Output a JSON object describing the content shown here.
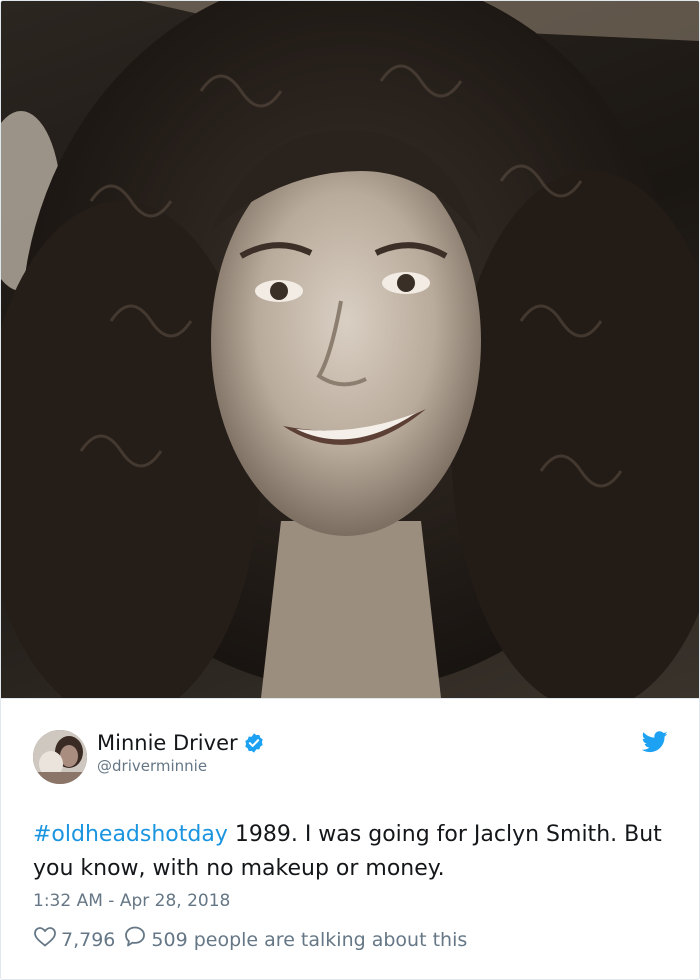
{
  "tweet": {
    "author": {
      "display_name": "Minnie Driver",
      "handle": "@driverminnie",
      "verified": true
    },
    "text": {
      "hashtag": "#oldheadshotday",
      "body": " 1989. I was going for Jaclyn Smith. But you know, with no makeup or money."
    },
    "timestamp": "1:32 AM - Apr 28, 2018",
    "actions": {
      "likes": "7,796",
      "replies_label": "509 people are talking about this"
    },
    "icons": {
      "brand": "twitter-bird-icon",
      "verified": "verified-badge-icon",
      "like": "heart-icon",
      "reply": "speech-bubble-icon"
    },
    "colors": {
      "link": "#1b95e0",
      "verified": "#1da1f2",
      "muted": "#657786"
    }
  }
}
